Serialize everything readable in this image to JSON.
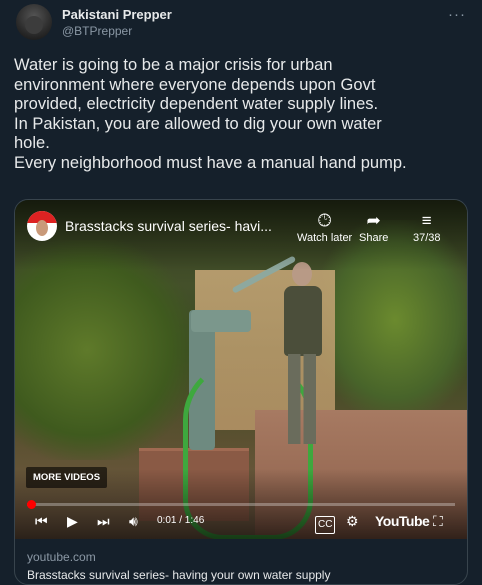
{
  "tweet": {
    "author_name": "Pakistani Prepper",
    "author_handle": "@BTPrepper",
    "more_icon": "more-dots-icon",
    "text": "Water is going to be a major crisis for urban\nenvironment where everyone depends upon Govt\nprovided, electricity dependent water supply lines.\nIn Pakistan, you are allowed to dig your own water\nhole.\nEvery neighborhood must have a manual hand pump."
  },
  "video": {
    "title": "Brasstacks survival series- havi...",
    "watch_later_label": "Watch later",
    "share_label": "Share",
    "playlist_count": "37/38",
    "more_videos_label": "MORE VIDEOS",
    "time": "0:01 / 1:46",
    "progress": 0.01,
    "brand_logo_text": "YouTube",
    "icons": {
      "watch_later": "clock-icon",
      "share": "share-arrow-icon",
      "playlist": "playlist-icon",
      "prev": "skip-previous-icon",
      "play": "play-icon",
      "next": "skip-next-icon",
      "volume": "volume-icon",
      "captions": "cc-icon",
      "settings": "gear-icon",
      "fullscreen": "fullscreen-icon"
    }
  },
  "card": {
    "domain": "youtube.com",
    "title": "Brasstacks survival series- having your own water supply"
  },
  "colors": {
    "background": "#15202b",
    "text": "#e7e9ea",
    "muted": "#8b98a5",
    "border": "#38444d",
    "progress": "#ff0000"
  }
}
